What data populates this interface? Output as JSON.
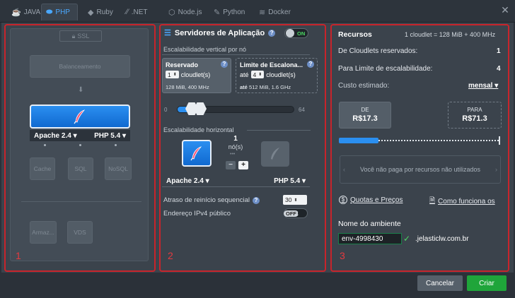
{
  "tabs": [
    {
      "label": "JAVA",
      "icon": "java-icon"
    },
    {
      "label": "PHP",
      "icon": "php-icon",
      "active": true
    },
    {
      "label": "Ruby",
      "icon": "ruby-icon"
    },
    {
      "label": ".NET",
      "icon": "dotnet-icon"
    },
    {
      "label": "Node.js",
      "icon": "nodejs-icon"
    },
    {
      "label": "Python",
      "icon": "python-icon"
    },
    {
      "label": "Docker",
      "icon": "docker-icon"
    }
  ],
  "panel_numbers": [
    "1",
    "2",
    "3"
  ],
  "topology": {
    "ssl_label": "SSL",
    "balancer_label": "Balanceamento",
    "app_server": {
      "engine": "Apache 2.4",
      "php": "PHP 5.4"
    },
    "middle_nodes": [
      "Cache",
      "SQL",
      "NoSQL"
    ],
    "bottom_nodes": [
      "Armaz...",
      "VDS"
    ]
  },
  "app_servers": {
    "title": "Servidores de Aplicação",
    "toggle_label": "ON",
    "vertical_label": "Escalabilidade vertical por nó",
    "reserved": {
      "title": "Reservado",
      "value": "1",
      "unit": "cloudlet(s)",
      "info": "128 MiB, 400 MHz"
    },
    "limit": {
      "title": "Limite de Escalona...",
      "prefix": "até",
      "value": "4",
      "unit": "cloudlet(s)",
      "info_prefix": "até",
      "info": "512 MiB, 1.6 GHz"
    },
    "slider": {
      "min": "0",
      "max": "64",
      "reserved": 1,
      "limit": 4
    },
    "horizontal_label": "Escalabilidade horizontal",
    "nodes_count": "1",
    "nodes_unit": "nó(s)",
    "engine": "Apache 2.4",
    "php": "PHP 5.4",
    "restart_delay_label": "Atraso de reinício sequencial",
    "restart_delay_value": "30",
    "ipv4_label": "Endereço IPv4 público",
    "ipv4_toggle": "OFF"
  },
  "resources": {
    "title": "Recursos",
    "cloudlet_info": "1 cloudlet = 128 MiB + 400 MHz",
    "reserved_prefix": "De",
    "reserved_label": "Cloudlets reservados:",
    "reserved_value": "1",
    "limit_prefix": "Para",
    "limit_label": "Limite de escalabilidade:",
    "limit_value": "4",
    "cost_label": "Custo estimado:",
    "period": "mensal",
    "from_label": "DE",
    "from_value": "R$17.3",
    "to_label": "PARA",
    "to_value": "R$71.3",
    "usage_fraction": 0.25,
    "hint": "Você não paga por recursos não utilizados",
    "quotas_link": "Quotas e Preços",
    "how_link": "Como funciona os",
    "env_label": "Nome do ambiente",
    "env_value": "env-4998430",
    "domain_suffix": ".jelasticlw.com.br"
  },
  "footer": {
    "cancel": "Cancelar",
    "create": "Criar"
  },
  "colors": {
    "accent": "#2b8ff0",
    "highlight": "#c8242b",
    "create": "#1fa53a"
  }
}
